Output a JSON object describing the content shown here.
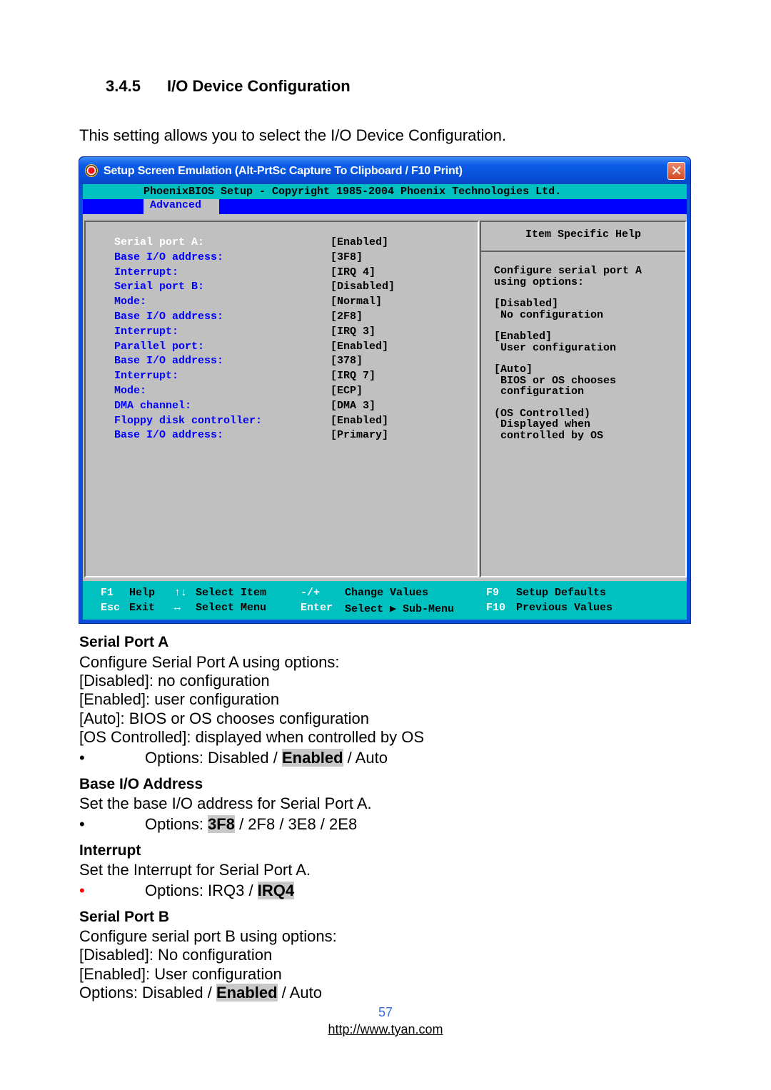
{
  "section": {
    "number": "3.4.5",
    "title": "I/O Device Configuration",
    "intro": "This setting allows you to select the I/O Device Configuration."
  },
  "window": {
    "title": "Setup Screen Emulation (Alt-PrtSc Capture To Clipboard / F10 Print)",
    "close_label": "✕",
    "bios_header": "PhoenixBIOS Setup - Copyright 1985-2004 Phoenix Technologies Ltd.",
    "active_tab": "Advanced",
    "settings": [
      {
        "label": "Serial port A:",
        "value": "[Enabled]",
        "selected": true
      },
      {
        "label": "Base I/O address:",
        "value": "[3F8]"
      },
      {
        "label": "Interrupt:",
        "value": "[IRQ 4]"
      },
      {
        "label": "Serial port B:",
        "value": "[Disabled]"
      },
      {
        "label": "Mode:",
        "value": "[Normal]"
      },
      {
        "label": "Base I/O address:",
        "value": "[2F8]"
      },
      {
        "label": "Interrupt:",
        "value": "[IRQ 3]"
      },
      {
        "label": "Parallel port:",
        "value": "[Enabled]"
      },
      {
        "label": "Base I/O address:",
        "value": "[378]"
      },
      {
        "label": "Interrupt:",
        "value": "[IRQ 7]"
      },
      {
        "label": "Mode:",
        "value": "[ECP]"
      },
      {
        "label": "DMA channel:",
        "value": "[DMA 3]"
      },
      {
        "label": "Floppy disk controller:",
        "value": "[Enabled]"
      },
      {
        "label": "Base I/O address:",
        "value": "[Primary]"
      }
    ],
    "help": {
      "title": "Item Specific Help",
      "lines": [
        "Configure serial port A",
        "using options:",
        "",
        "[Disabled]",
        " No configuration",
        "",
        "[Enabled]",
        " User configuration",
        "",
        "[Auto]",
        " BIOS or OS chooses",
        " configuration",
        "",
        "(OS Controlled)",
        " Displayed when",
        " controlled by OS"
      ]
    },
    "footer": {
      "row1": [
        {
          "key": "F1",
          "desc": "Help"
        },
        {
          "key": "↑↓",
          "desc": "Select Item"
        },
        {
          "key": "-/+",
          "desc": "Change Values"
        },
        {
          "key": "F9",
          "desc": "Setup Defaults"
        }
      ],
      "row2": [
        {
          "key": "Esc",
          "desc": "Exit"
        },
        {
          "key": "↔",
          "desc": "Select Menu"
        },
        {
          "key": "Enter",
          "desc": "Select ▶ Sub-Menu"
        },
        {
          "key": "F10",
          "desc": "Previous Values"
        }
      ]
    }
  },
  "serial_port_a": {
    "heading": "Serial Port A",
    "lines": [
      "Configure Serial Port A using options:",
      "[Disabled]: no configuration",
      "[Enabled]: user configuration",
      "[Auto]: BIOS or OS chooses configuration",
      "[OS Controlled]: displayed when controlled by OS"
    ],
    "bullet": "•",
    "options_prefix": "Options: Disabled / ",
    "options_default": "Enabled",
    "options_suffix": " / Auto"
  },
  "base_io": {
    "heading": "Base I/O Address",
    "line": "Set the base I/O address for Serial Port A.",
    "bullet": "•",
    "options_prefix": "Options: ",
    "options_default": "3F8",
    "options_suffix": " / 2F8 / 3E8 / 2E8"
  },
  "interrupt": {
    "heading": "Interrupt",
    "line": "Set the Interrupt for Serial Port A.",
    "bullet": "•",
    "options_prefix": "Options: IRQ3 / ",
    "options_default": "IRQ4",
    "options_suffix": ""
  },
  "serial_port_b": {
    "heading": "Serial Port B",
    "lines": [
      "Configure serial port B using options:",
      "[Disabled]: No configuration",
      "[Enabled]: User configuration"
    ],
    "options_prefix": "Options: Disabled / ",
    "options_default": "Enabled",
    "options_suffix": " / Auto"
  },
  "page": {
    "number": "57",
    "url": "http://www.tyan.com"
  },
  "colors": {
    "bios_cyan": "#00c0c0",
    "bios_blue": "#0000ff",
    "bios_gray": "#c0c0c0",
    "page_number": "#3a6ae8",
    "bullet_red": "#ff0000"
  }
}
